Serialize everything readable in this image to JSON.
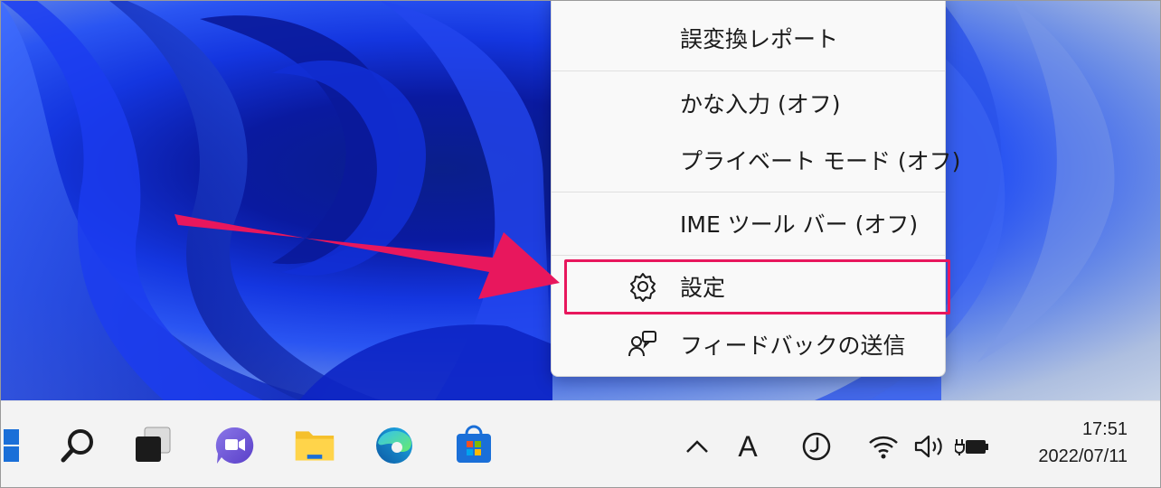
{
  "menu": {
    "items": [
      {
        "label": "誤変換レポート"
      },
      {
        "label": "かな入力 (オフ)"
      },
      {
        "label": "プライベート モード (オフ)"
      },
      {
        "label": "IME ツール バー (オフ)"
      },
      {
        "label": "設定",
        "icon": "gear-icon"
      },
      {
        "label": "フィードバックの送信",
        "icon": "feedback-icon"
      }
    ]
  },
  "annotation": {
    "highlight_color": "#e8175d",
    "target": "設定"
  },
  "taskbar": {
    "apps": [
      "start-icon",
      "search-icon",
      "task-view-icon",
      "teams-chat-icon",
      "file-explorer-icon",
      "edge-icon",
      "store-icon"
    ],
    "tray": {
      "chevron": "^",
      "ime_mode": "A",
      "ime_icon": "ime-kana-icon",
      "network_icon": "wifi-icon",
      "volume_icon": "speaker-icon",
      "battery_icon": "battery-charging-icon"
    },
    "clock": {
      "time": "17:51",
      "date": "2022/07/11"
    }
  }
}
